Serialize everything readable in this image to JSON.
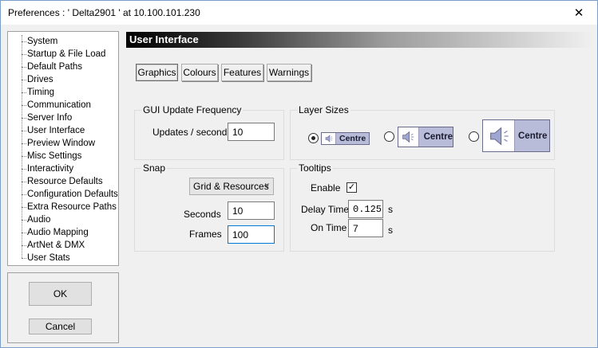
{
  "window": {
    "title": "Preferences  :  ' Delta2901 '  at  10.100.101.230",
    "close_glyph": "✕"
  },
  "tree": {
    "items": [
      "System",
      "Startup & File Load",
      "Default Paths",
      "Drives",
      "Timing",
      "Communication",
      "Server Info",
      "User Interface",
      "Preview Window",
      "Misc Settings",
      "Interactivity",
      "Resource Defaults",
      "Configuration Defaults",
      "Extra Resource Paths",
      "Audio",
      "Audio Mapping",
      "ArtNet & DMX",
      "User Stats"
    ],
    "selected": "User Interface"
  },
  "buttons": {
    "ok": "OK",
    "cancel": "Cancel"
  },
  "section": {
    "title": "User Interface"
  },
  "tabs": [
    {
      "label": "Graphics",
      "active": true
    },
    {
      "label": "Colours",
      "active": false
    },
    {
      "label": "Features",
      "active": false
    },
    {
      "label": "Warnings",
      "active": false
    }
  ],
  "gui_update": {
    "title": "GUI Update Frequency",
    "label": "Updates / second",
    "value": "10"
  },
  "layer_sizes": {
    "title": "Layer Sizes",
    "options": [
      {
        "label": "Centre",
        "checked": true
      },
      {
        "label": "Centre",
        "checked": false
      },
      {
        "label": "Centre",
        "checked": false
      }
    ],
    "icon": "speaker-icon"
  },
  "snap": {
    "title": "Snap",
    "mode": "Grid & Resources",
    "seconds_label": "Seconds",
    "seconds_value": "10",
    "frames_label": "Frames",
    "frames_value": "100"
  },
  "tooltips": {
    "title": "Tooltips",
    "enable_label": "Enable",
    "enable_checked": true,
    "check_glyph": "✓",
    "delay_label": "Delay Time",
    "delay_value": "0.125",
    "delay_unit": "s",
    "on_label": "On Time",
    "on_value": "7",
    "on_unit": "s"
  },
  "colors": {
    "header_start": "#000000",
    "chip_bg": "#b8bcd8",
    "focus_border": "#0078d7"
  }
}
